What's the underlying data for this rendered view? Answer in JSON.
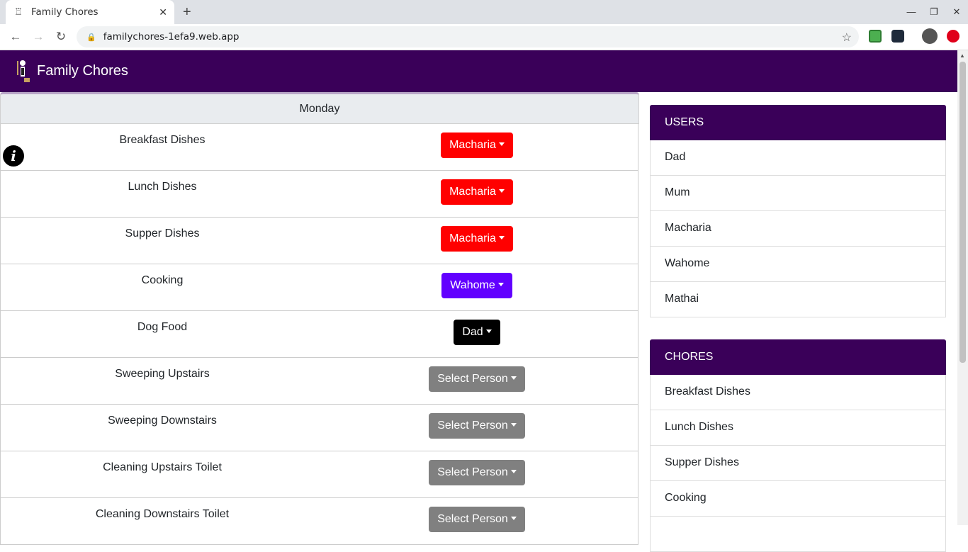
{
  "browser": {
    "tab_title": "Family Chores",
    "url": "familychores-1efa9.web.app"
  },
  "app": {
    "title": "Family Chores"
  },
  "schedule": {
    "day": "Monday",
    "chores": [
      {
        "name": "Breakfast Dishes",
        "person": "Macharia",
        "color": "#ff0000"
      },
      {
        "name": "Lunch Dishes",
        "person": "Macharia",
        "color": "#ff0000"
      },
      {
        "name": "Supper Dishes",
        "person": "Macharia",
        "color": "#ff0000"
      },
      {
        "name": "Cooking",
        "person": "Wahome",
        "color": "#6200ff"
      },
      {
        "name": "Dog Food",
        "person": "Dad",
        "color": "#000000"
      },
      {
        "name": "Sweeping Upstairs",
        "person": "Select Person",
        "color": "#808080"
      },
      {
        "name": "Sweeping Downstairs",
        "person": "Select Person",
        "color": "#808080"
      },
      {
        "name": "Cleaning Upstairs Toilet",
        "person": "Select Person",
        "color": "#808080"
      },
      {
        "name": "Cleaning Downstairs Toilet",
        "person": "Select Person",
        "color": "#808080"
      }
    ]
  },
  "users_card": {
    "header": "USERS",
    "items": [
      "Dad",
      "Mum",
      "Macharia",
      "Wahome",
      "Mathai"
    ]
  },
  "chores_card": {
    "header": "CHORES",
    "items": [
      "Breakfast Dishes",
      "Lunch Dishes",
      "Supper Dishes",
      "Cooking",
      ""
    ]
  }
}
